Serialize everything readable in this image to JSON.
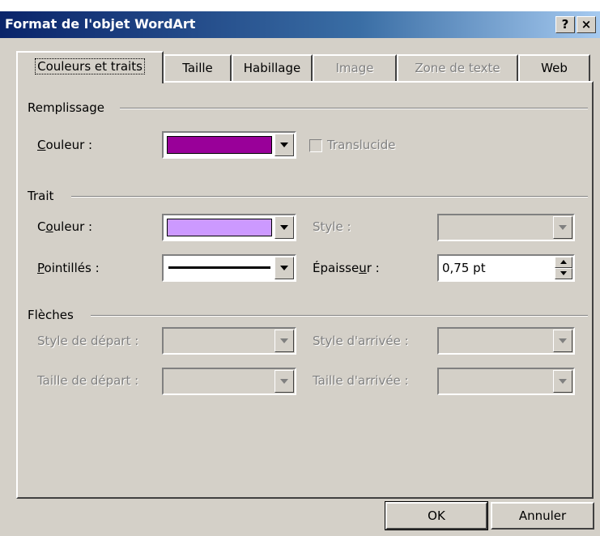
{
  "window": {
    "title": "Format de l'objet WordArt",
    "help_label": "?",
    "close_label": "×"
  },
  "tabs": [
    {
      "label": "Couleurs et traits",
      "state": "active"
    },
    {
      "label": "Taille",
      "state": "enabled"
    },
    {
      "label": "Habillage",
      "state": "enabled"
    },
    {
      "label": "Image",
      "state": "disabled"
    },
    {
      "label": "Zone de texte",
      "state": "disabled"
    },
    {
      "label": "Web",
      "state": "enabled"
    }
  ],
  "fill": {
    "section_label": "Remplissage",
    "color_label_key": "C",
    "color_label_rest": "ouleur :",
    "color_value": "#990099",
    "translucent_label": "Translucide",
    "translucent_checked": false,
    "translucent_enabled": false
  },
  "line": {
    "section_label": "Trait",
    "color_label_before": "C",
    "color_label_key": "o",
    "color_label_after": "uleur :",
    "color_value": "#cc99ff",
    "style_label": "Style :",
    "dashed_label_key": "P",
    "dashed_label_rest": "ointillés :",
    "dashed_value": "solid",
    "weight_label_before": "Épaisse",
    "weight_label_key": "u",
    "weight_label_after": "r :",
    "weight_value": "0,75 pt"
  },
  "arrows": {
    "section_label": "Flèches",
    "begin_style_label": "Style de départ :",
    "end_style_label": "Style d'arrivée :",
    "begin_size_label": "Taille de départ :",
    "end_size_label": "Taille d'arrivée :",
    "enabled": false
  },
  "footer": {
    "ok_label": "OK",
    "cancel_label": "Annuler"
  }
}
